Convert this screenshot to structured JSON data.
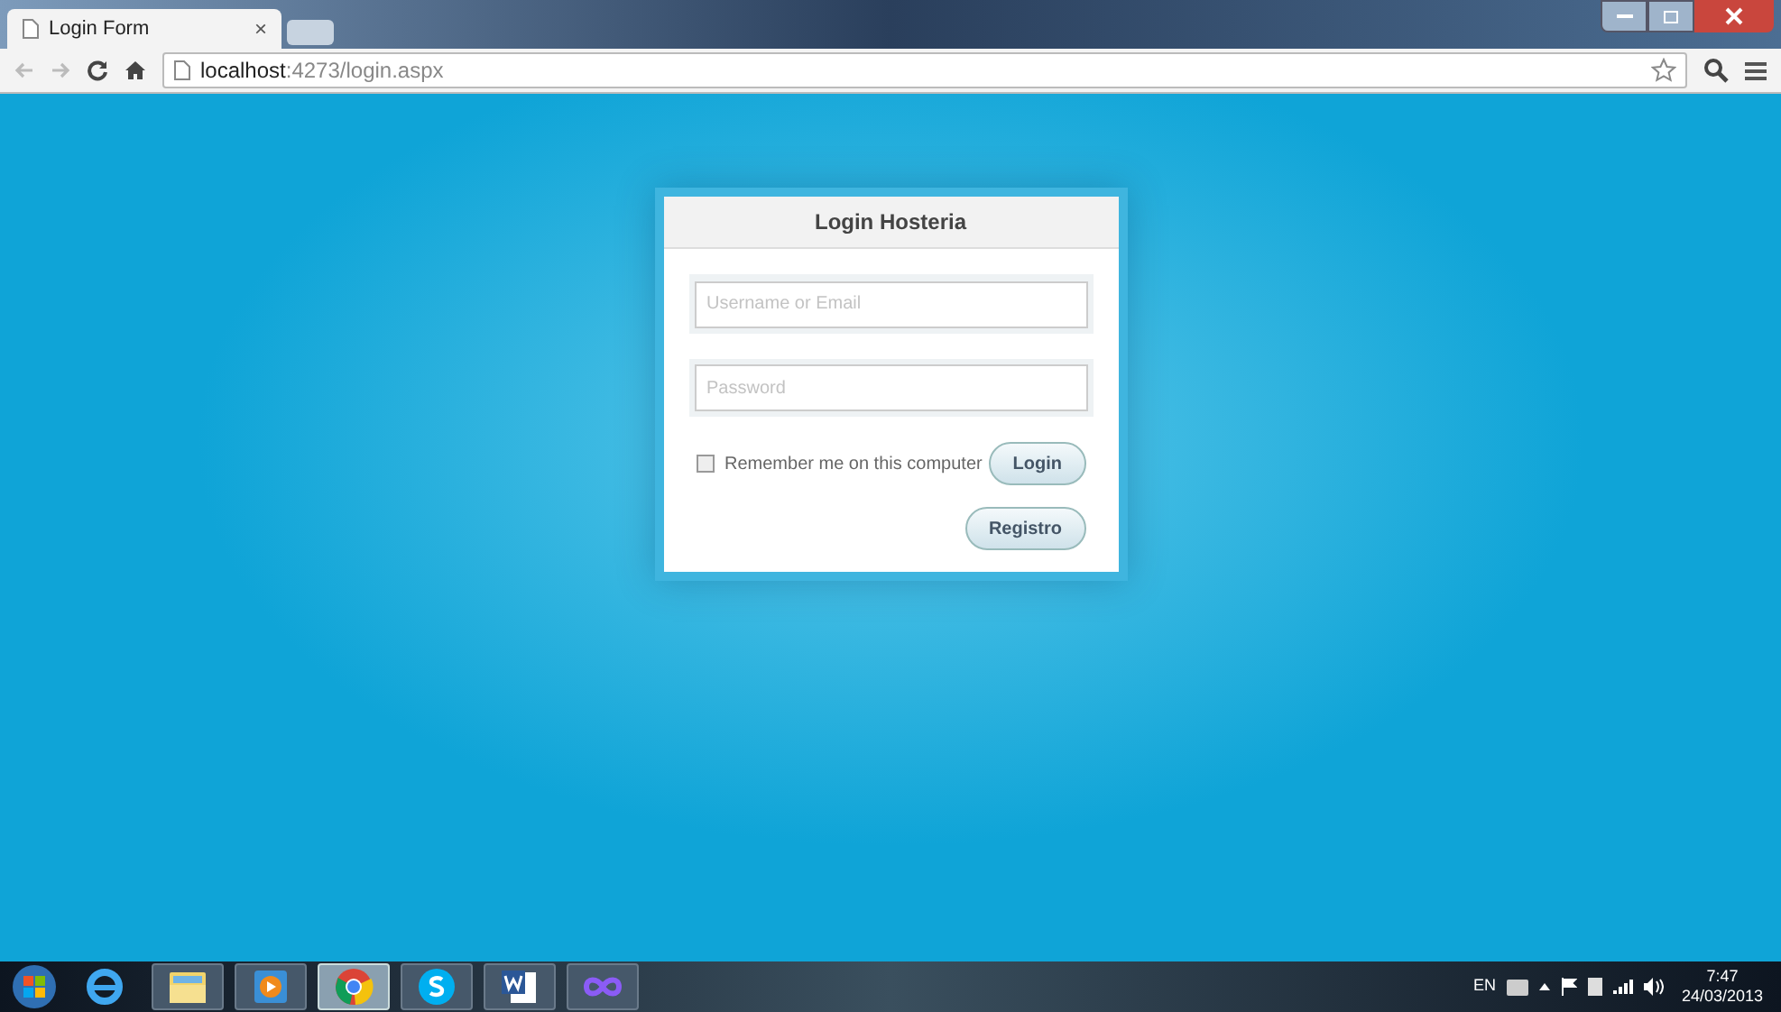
{
  "browser": {
    "tab": {
      "title": "Login Form",
      "close": "×"
    },
    "address": {
      "host": "localhost",
      "path": ":4273/login.aspx"
    }
  },
  "login": {
    "title": "Login Hosteria",
    "fields": [
      {
        "placeholder": "Username or Email"
      },
      {
        "placeholder": "Password"
      }
    ],
    "remember": {
      "label": "Remember me on this computer",
      "checked": false
    },
    "buttons": [
      "Login",
      "Registro"
    ]
  },
  "taskbar": {
    "apps": [
      {
        "kind": "ie",
        "active": false
      },
      {
        "kind": "folder",
        "active": false
      },
      {
        "kind": "media",
        "active": false
      },
      {
        "kind": "chrome",
        "active": true
      },
      {
        "kind": "skype",
        "active": false
      },
      {
        "kind": "word",
        "active": false
      },
      {
        "kind": "infinity",
        "active": false
      }
    ],
    "tray": {
      "language": "EN",
      "time": "7:47",
      "date": "24/03/2013"
    }
  }
}
